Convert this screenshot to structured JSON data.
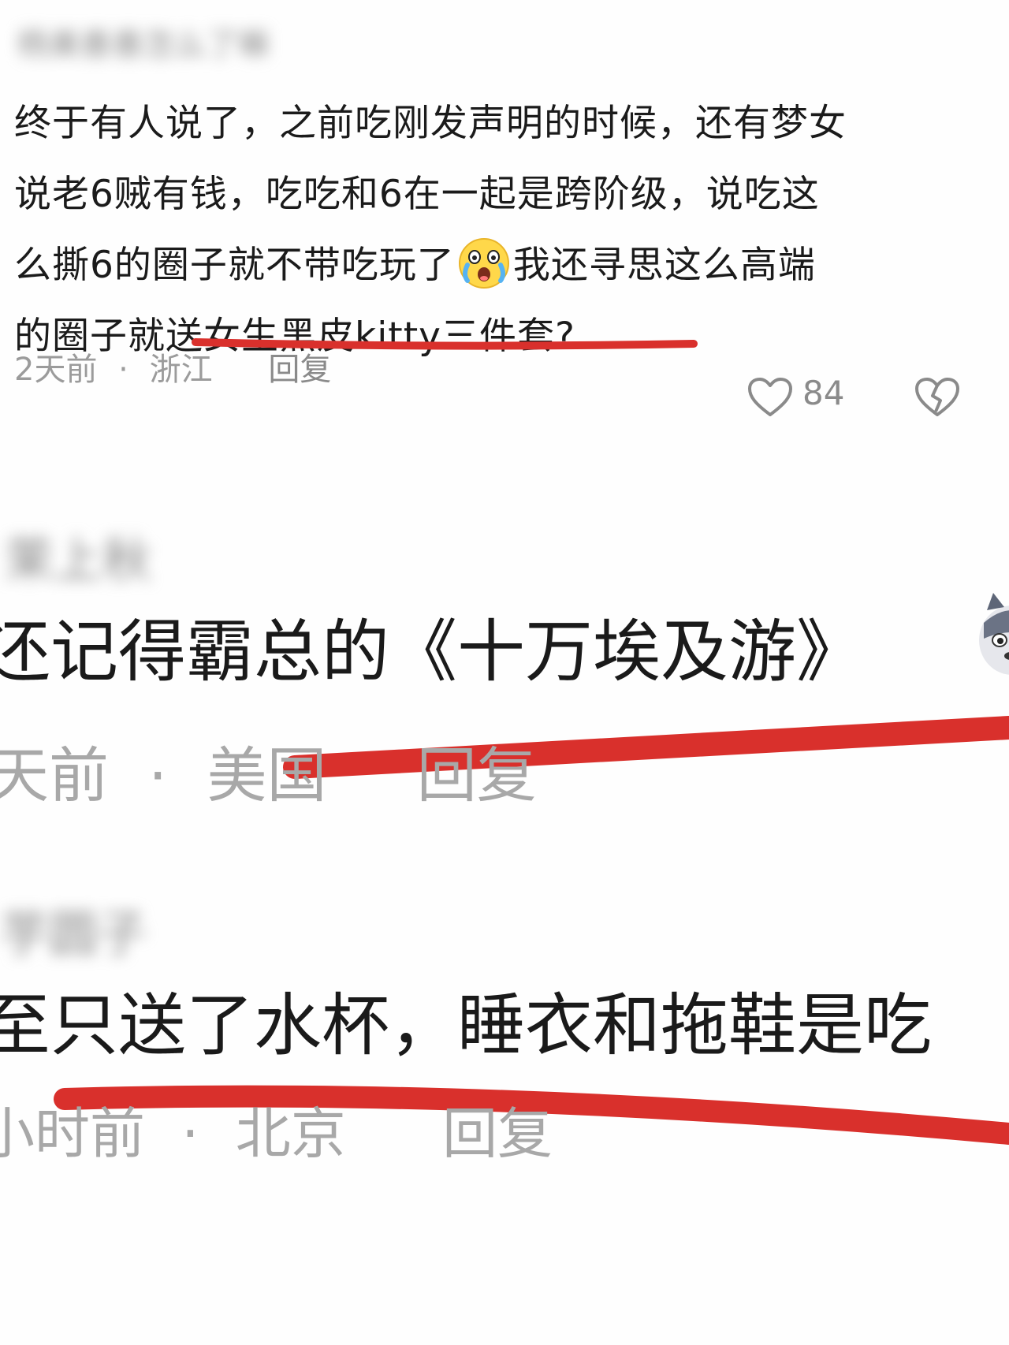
{
  "comments": [
    {
      "username": "杨美善善怎么了嘛",
      "lines": [
        "终于有人说了，之前吃刚发声明的时候，还有梦女",
        "说老6贼有钱，吃吃和6在一起是跨阶级，说吃这",
        "么撕6的圈子就不带吃玩了",
        "我还寻思这么高端",
        "的圈子就送女生黑皮kitty三件套?"
      ],
      "emoji": "crying-laughing-emoji",
      "time": "2天前",
      "separator": "·",
      "location": "浙江",
      "reply": "回复",
      "likes": "84"
    },
    {
      "username": "茉上秋",
      "text": "还记得霸总的《十万埃及游》",
      "time": "天前",
      "separator": "·",
      "location": "美国",
      "reply": "回复"
    },
    {
      "username": "芋圆子",
      "text": "至只送了水杯，睡衣和拖鞋是吃",
      "time": "小时前",
      "separator": "·",
      "location": "北京",
      "reply": "回复"
    }
  ],
  "colors": {
    "annotation_red": "#d9302c",
    "meta_gray": "#9b9b9b",
    "text": "#1b1b1b"
  }
}
